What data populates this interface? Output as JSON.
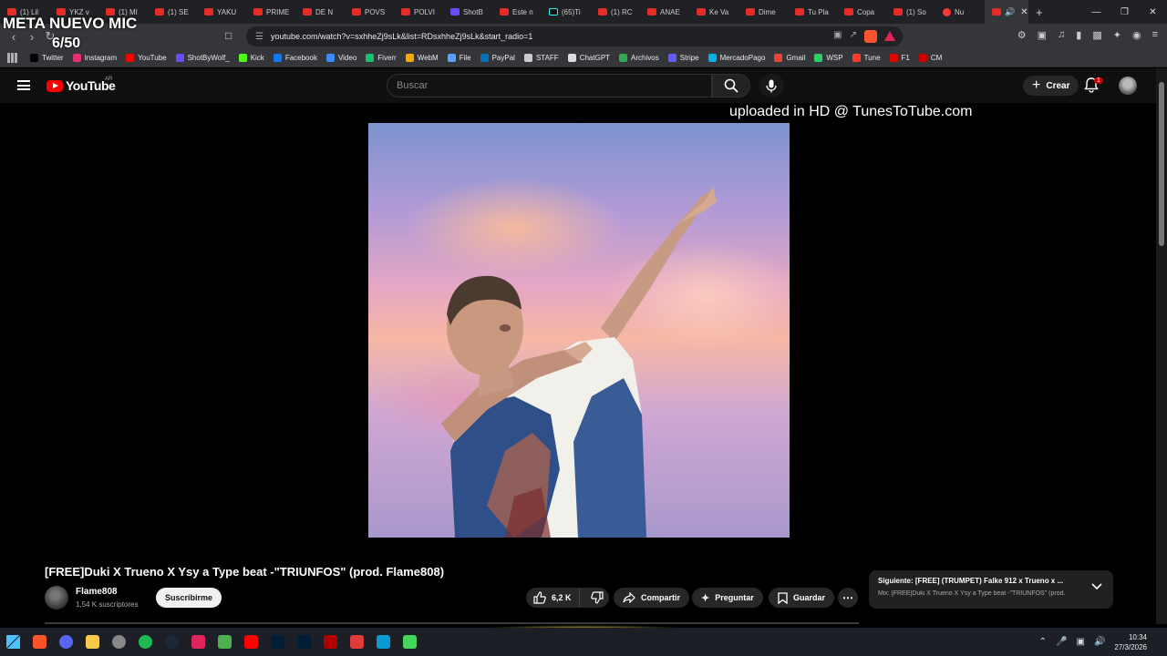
{
  "overlay": {
    "title": "META NUEVO MIC",
    "count": "6/50"
  },
  "browser": {
    "tabs": [
      {
        "label": "(1) Lil",
        "icon": "youtube-icon"
      },
      {
        "label": "YKZ v",
        "icon": "youtube-icon"
      },
      {
        "label": "(1) MI",
        "icon": "youtube-icon"
      },
      {
        "label": "(1) SE",
        "icon": "youtube-icon"
      },
      {
        "label": "YAKU",
        "icon": "youtube-icon"
      },
      {
        "label": "PRIME",
        "icon": "youtube-icon"
      },
      {
        "label": "DE N",
        "icon": "youtube-icon"
      },
      {
        "label": "POVS",
        "icon": "youtube-icon"
      },
      {
        "label": "POLVI",
        "icon": "youtube-icon"
      },
      {
        "label": "ShotB",
        "icon": "shotbywolf-icon"
      },
      {
        "label": "Este n",
        "icon": "youtube-icon"
      },
      {
        "label": "(65)Ti",
        "icon": "tiktok-icon"
      },
      {
        "label": "(1) RC",
        "icon": "youtube-icon"
      },
      {
        "label": "ANAE",
        "icon": "youtube-icon"
      },
      {
        "label": "Ke Va",
        "icon": "youtube-icon"
      },
      {
        "label": "Dime",
        "icon": "youtube-icon"
      },
      {
        "label": "Tu Pla",
        "icon": "youtube-icon"
      },
      {
        "label": "Copa",
        "icon": "youtube-icon"
      },
      {
        "label": "(1) So",
        "icon": "youtube-icon"
      },
      {
        "label": "Nu",
        "icon": "opera-icon"
      }
    ],
    "url": "youtube.com/watch?v=sxhheZj9sLk&list=RDsxhheZj9sLk&start_radio=1",
    "bookmarks": [
      {
        "label": "Twitter",
        "color": "#000000"
      },
      {
        "label": "Instagram",
        "color": "#e1306c"
      },
      {
        "label": "YouTube",
        "color": "#ff0000"
      },
      {
        "label": "ShotByWolf_",
        "color": "#6a4cff"
      },
      {
        "label": "Kick",
        "color": "#53fc18"
      },
      {
        "label": "Facebook",
        "color": "#1877f2"
      },
      {
        "label": "Video",
        "color": "#3d8bff"
      },
      {
        "label": "Fiverr",
        "color": "#1dbf73"
      },
      {
        "label": "WebM",
        "color": "#ffa500"
      },
      {
        "label": "File",
        "color": "#5aa0ff"
      },
      {
        "label": "PayPal",
        "color": "#0070ba"
      },
      {
        "label": "STAFF",
        "color": "#cccccc"
      },
      {
        "label": "ChatGPT",
        "color": "#dddddd"
      },
      {
        "label": "Archivos",
        "color": "#34a853"
      },
      {
        "label": "Stripe",
        "color": "#635bff"
      },
      {
        "label": "MercadoPago",
        "color": "#00b1ea"
      },
      {
        "label": "Gmail",
        "color": "#ea4335"
      },
      {
        "label": "WSP",
        "color": "#25d366"
      },
      {
        "label": "Tune",
        "color": "#ff3b30"
      },
      {
        "label": "F1",
        "color": "#e10600"
      },
      {
        "label": "CM",
        "color": "#cc0000"
      }
    ]
  },
  "youtube": {
    "logo_text": "YouTube",
    "country": "AR",
    "search_placeholder": "Buscar",
    "create_label": "Crear",
    "notification_count": "1",
    "watermark": "uploaded in HD @ TunesToTube.com",
    "video_title": "[FREE]Duki X Trueno X Ysy a Type beat -\"TRIUNFOS\" (prod. Flame808)",
    "channel_name": "Flame808",
    "channel_subs": "1,54 K suscriptores",
    "subscribe_label": "Suscribirme",
    "likes": "6,2 K",
    "share_label": "Compartir",
    "ask_label": "Preguntar",
    "save_label": "Guardar",
    "next_label": "Siguiente: [FREE] (TRUMPET) Falke 912 x Trueno x ...",
    "next_mix": "Mix: [FREE]Duki X Trueno X Ysy a Type beat -\"TRIUNFOS\" (prod."
  },
  "taskbar": {
    "apps": [
      {
        "name": "windows-start",
        "color": "#0a84ff"
      },
      {
        "name": "brave",
        "color": "#fb542b"
      },
      {
        "name": "discord",
        "color": "#5865f2"
      },
      {
        "name": "file-explorer",
        "color": "#f7c948"
      },
      {
        "name": "chrome",
        "color": "#888888"
      },
      {
        "name": "spotify",
        "color": "#1db954"
      },
      {
        "name": "steam",
        "color": "#1b2838"
      },
      {
        "name": "adobe",
        "color": "#e0245e"
      },
      {
        "name": "minecraft",
        "color": "#4caf50"
      },
      {
        "name": "youtube",
        "color": "#ff0000"
      },
      {
        "name": "photoshop",
        "color": "#001e36"
      },
      {
        "name": "lightroom",
        "color": "#001e36"
      },
      {
        "name": "red-app",
        "color": "#b00000"
      },
      {
        "name": "flstudio",
        "color": "#e03a3a"
      },
      {
        "name": "capcut",
        "color": "#0a9bd6"
      },
      {
        "name": "h-app",
        "color": "#43d65b"
      }
    ],
    "time": "10:34",
    "date": "27/3/2026"
  }
}
